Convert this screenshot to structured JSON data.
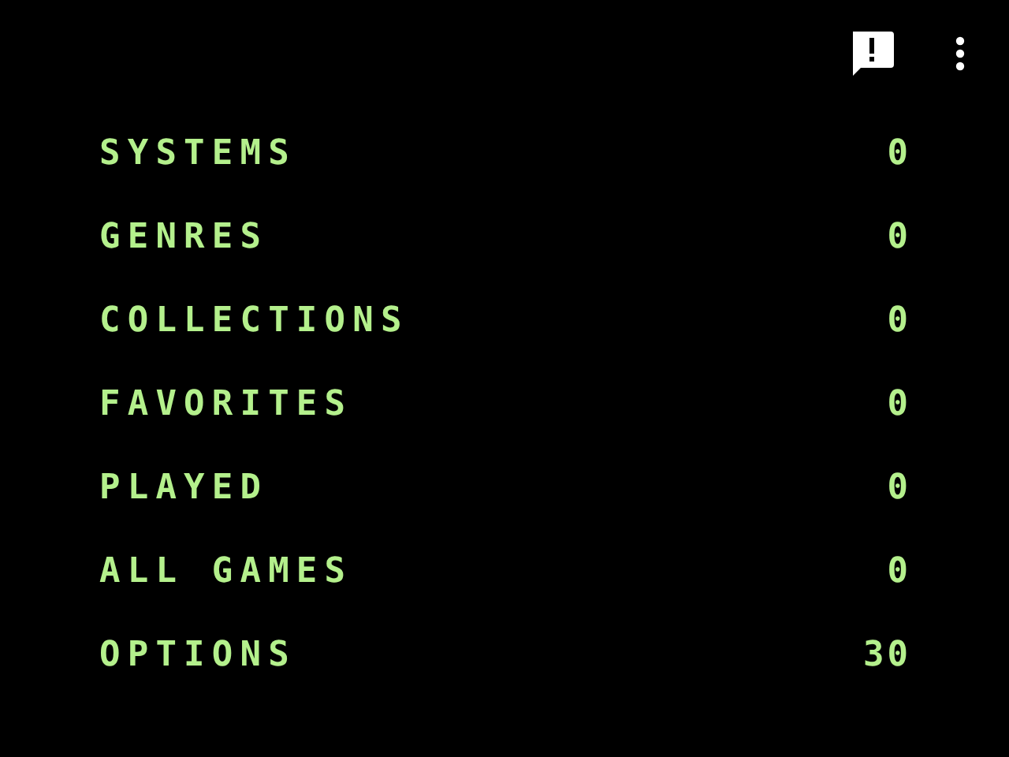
{
  "menu": [
    {
      "label": "SYSTEMS",
      "count": "0"
    },
    {
      "label": "GENRES",
      "count": "0"
    },
    {
      "label": "COLLECTIONS",
      "count": "0"
    },
    {
      "label": "FAVORITES",
      "count": "0"
    },
    {
      "label": "PLAYED",
      "count": "0"
    },
    {
      "label": "ALL GAMES",
      "count": "0"
    },
    {
      "label": "OPTIONS",
      "count": "30"
    }
  ]
}
